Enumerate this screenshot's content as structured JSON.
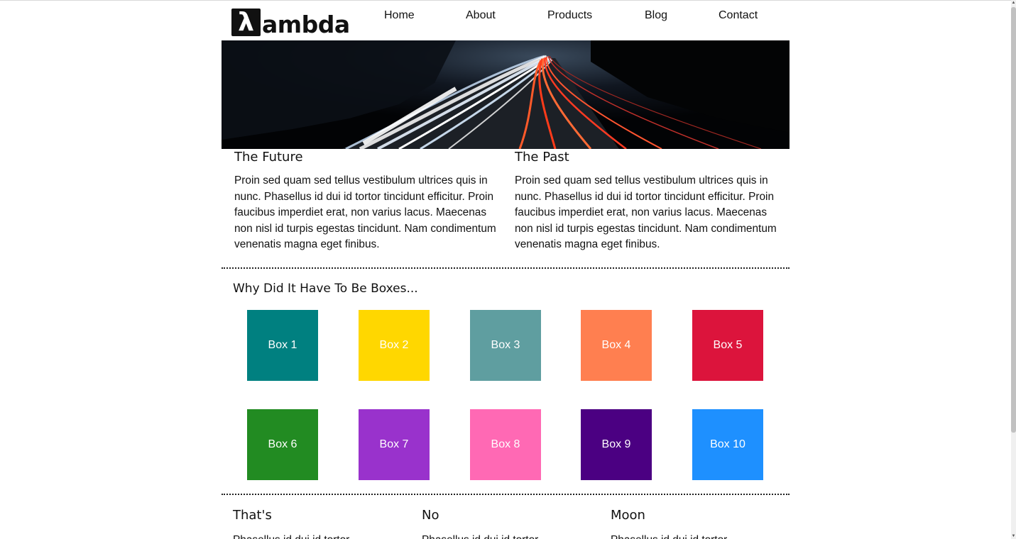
{
  "header": {
    "logo_text": "ambda",
    "logo_mark": "λ",
    "nav": [
      "Home",
      "About",
      "Products",
      "Blog",
      "Contact"
    ]
  },
  "hero": {
    "image_subject": "long-exposure highway light trails at night"
  },
  "sections": {
    "left": {
      "title": "The Future",
      "body": "Proin sed quam sed tellus vestibulum ultrices quis in nunc. Phasellus id dui id tortor tincidunt efficitur. Proin faucibus imperdiet erat, non varius lacus. Maecenas non nisl id turpis egestas tincidunt. Nam condimentum venenatis magna eget finibus."
    },
    "right": {
      "title": "The Past",
      "body": "Proin sed quam sed tellus vestibulum ultrices quis in nunc. Phasellus id dui id tortor tincidunt efficitur. Proin faucibus imperdiet erat, non varius lacus. Maecenas non nisl id turpis egestas tincidunt. Nam condimentum venenatis magna eget finibus."
    }
  },
  "boxes": {
    "title": "Why Did It Have To Be Boxes...",
    "items": [
      {
        "label": "Box 1",
        "color": "#008080"
      },
      {
        "label": "Box 2",
        "color": "#FFD700"
      },
      {
        "label": "Box 3",
        "color": "#5F9EA0"
      },
      {
        "label": "Box 4",
        "color": "#FF7F50"
      },
      {
        "label": "Box 5",
        "color": "#DC143C"
      },
      {
        "label": "Box 6",
        "color": "#228B22"
      },
      {
        "label": "Box 7",
        "color": "#9932CC"
      },
      {
        "label": "Box 8",
        "color": "#FF69B4"
      },
      {
        "label": "Box 9",
        "color": "#4B0082"
      },
      {
        "label": "Box 10",
        "color": "#1E90FF"
      }
    ]
  },
  "bottom": [
    {
      "title": "That's",
      "body": "Phasellus id dui id tortor"
    },
    {
      "title": "No",
      "body": "Phasellus id dui id tortor"
    },
    {
      "title": "Moon",
      "body": "Phasellus id dui id tortor"
    }
  ]
}
